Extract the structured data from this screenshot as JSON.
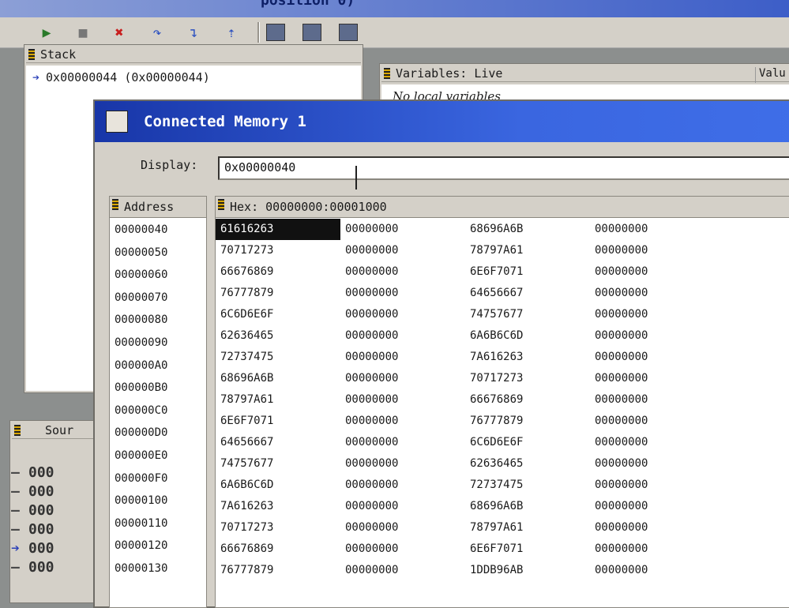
{
  "window_title": "position 0)",
  "toolbar": {
    "buttons": [
      "run-icon",
      "stop-icon",
      "reset-icon",
      "step-over-icon",
      "step-into-icon",
      "step-out-icon"
    ],
    "extra": [
      "registers-icon",
      "memory-icon",
      "settings-icon"
    ]
  },
  "stack": {
    "title": "Stack",
    "rows": [
      "0x00000044 (0x00000044)"
    ]
  },
  "variables": {
    "title": "Variables: Live",
    "empty_text": "No local variables",
    "value_col": "Valu"
  },
  "source": {
    "title": "Sour",
    "lines": [
      "000",
      "000",
      "000",
      "000",
      "000",
      "000"
    ]
  },
  "memory": {
    "title": "Connected Memory 1",
    "display_label": "Display:",
    "display_value": "0x00000040",
    "address_header": "Address",
    "hex_header": "Hex: 00000000:00001000",
    "addresses": [
      "00000040",
      "00000050",
      "00000060",
      "00000070",
      "00000080",
      "00000090",
      "000000A0",
      "000000B0",
      "000000C0",
      "000000D0",
      "000000E0",
      "000000F0",
      "00000100",
      "00000110",
      "00000120",
      "00000130"
    ],
    "rows": [
      [
        "61616263",
        "00000000",
        "68696A6B",
        "00000000"
      ],
      [
        "70717273",
        "00000000",
        "78797A61",
        "00000000"
      ],
      [
        "66676869",
        "00000000",
        "6E6F7071",
        "00000000"
      ],
      [
        "76777879",
        "00000000",
        "64656667",
        "00000000"
      ],
      [
        "6C6D6E6F",
        "00000000",
        "74757677",
        "00000000"
      ],
      [
        "62636465",
        "00000000",
        "6A6B6C6D",
        "00000000"
      ],
      [
        "72737475",
        "00000000",
        "7A616263",
        "00000000"
      ],
      [
        "68696A6B",
        "00000000",
        "70717273",
        "00000000"
      ],
      [
        "78797A61",
        "00000000",
        "66676869",
        "00000000"
      ],
      [
        "6E6F7071",
        "00000000",
        "76777879",
        "00000000"
      ],
      [
        "64656667",
        "00000000",
        "6C6D6E6F",
        "00000000"
      ],
      [
        "74757677",
        "00000000",
        "62636465",
        "00000000"
      ],
      [
        "6A6B6C6D",
        "00000000",
        "72737475",
        "00000000"
      ],
      [
        "7A616263",
        "00000000",
        "68696A6B",
        "00000000"
      ],
      [
        "70717273",
        "00000000",
        "78797A61",
        "00000000"
      ],
      [
        "66676869",
        "00000000",
        "6E6F7071",
        "00000000"
      ],
      [
        "76777879",
        "00000000",
        "1DDB96AB",
        "00000000"
      ]
    ]
  }
}
